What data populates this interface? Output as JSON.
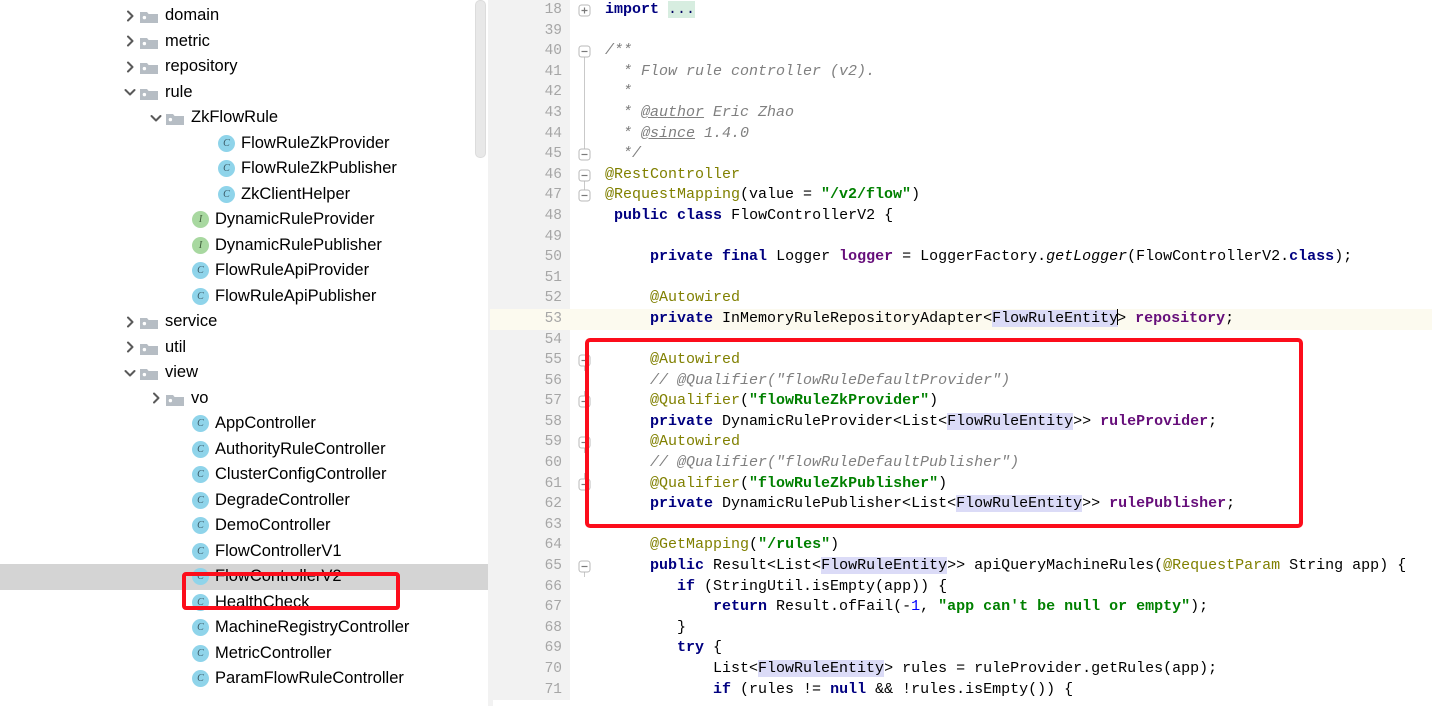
{
  "tree": {
    "scrollbar": {
      "visible": true
    },
    "items": [
      {
        "label": "domain",
        "indent": 1,
        "arrow": "right",
        "icon": "folder"
      },
      {
        "label": "metric",
        "indent": 1,
        "arrow": "right",
        "icon": "folder"
      },
      {
        "label": "repository",
        "indent": 1,
        "arrow": "right",
        "icon": "folder"
      },
      {
        "label": "rule",
        "indent": 1,
        "arrow": "down",
        "icon": "folder"
      },
      {
        "label": "ZkFlowRule",
        "indent": 2,
        "arrow": "down",
        "icon": "folder"
      },
      {
        "label": "FlowRuleZkProvider",
        "indent": 4,
        "arrow": "none",
        "icon": "class"
      },
      {
        "label": "FlowRuleZkPublisher",
        "indent": 4,
        "arrow": "none",
        "icon": "class"
      },
      {
        "label": "ZkClientHelper",
        "indent": 4,
        "arrow": "none",
        "icon": "class"
      },
      {
        "label": "DynamicRuleProvider",
        "indent": 3,
        "arrow": "none",
        "icon": "interface"
      },
      {
        "label": "DynamicRulePublisher",
        "indent": 3,
        "arrow": "none",
        "icon": "interface"
      },
      {
        "label": "FlowRuleApiProvider",
        "indent": 3,
        "arrow": "none",
        "icon": "class"
      },
      {
        "label": "FlowRuleApiPublisher",
        "indent": 3,
        "arrow": "none",
        "icon": "class"
      },
      {
        "label": "service",
        "indent": 1,
        "arrow": "right",
        "icon": "folder"
      },
      {
        "label": "util",
        "indent": 1,
        "arrow": "right",
        "icon": "folder"
      },
      {
        "label": "view",
        "indent": 1,
        "arrow": "down",
        "icon": "folder"
      },
      {
        "label": "vo",
        "indent": 2,
        "arrow": "right",
        "icon": "folder"
      },
      {
        "label": "AppController",
        "indent": 3,
        "arrow": "none",
        "icon": "class"
      },
      {
        "label": "AuthorityRuleController",
        "indent": 3,
        "arrow": "none",
        "icon": "class"
      },
      {
        "label": "ClusterConfigController",
        "indent": 3,
        "arrow": "none",
        "icon": "class"
      },
      {
        "label": "DegradeController",
        "indent": 3,
        "arrow": "none",
        "icon": "class"
      },
      {
        "label": "DemoController",
        "indent": 3,
        "arrow": "none",
        "icon": "class"
      },
      {
        "label": "FlowControllerV1",
        "indent": 3,
        "arrow": "none",
        "icon": "class"
      },
      {
        "label": "FlowControllerV2",
        "indent": 3,
        "arrow": "none",
        "icon": "class",
        "selected": true
      },
      {
        "label": "HealthCheck",
        "indent": 3,
        "arrow": "none",
        "icon": "class"
      },
      {
        "label": "MachineRegistryController",
        "indent": 3,
        "arrow": "none",
        "icon": "class"
      },
      {
        "label": "MetricController",
        "indent": 3,
        "arrow": "none",
        "icon": "class"
      },
      {
        "label": "ParamFlowRuleController",
        "indent": 3,
        "arrow": "none",
        "icon": "class"
      }
    ]
  },
  "annotations": {
    "tree_box_color": "#fc0d1b",
    "code_box_color": "#fc0d1b",
    "tree_box_target": "FlowControllerV2",
    "code_box_lines": "55-62"
  },
  "editor": {
    "current_line": 53,
    "lines": [
      {
        "num": "18",
        "fold": "plus",
        "html": "<span class=\"impkw\">import</span> <span class=\"foldtxt\">...</span>"
      },
      {
        "num": "39",
        "fold": "",
        "html": ""
      },
      {
        "num": "40",
        "fold": "minus-top",
        "html": "<span class=\"doc\">/**</span>"
      },
      {
        "num": "41",
        "fold": "line",
        "html": "<span class=\"doc\">  * Flow rule controller (v2).</span>"
      },
      {
        "num": "42",
        "fold": "line",
        "html": "<span class=\"doc\">  *</span>"
      },
      {
        "num": "43",
        "fold": "line",
        "html": "<span class=\"doc\">  * </span><span class=\"cmtu\">@author</span><span class=\"doc\"> Eric Zhao</span>"
      },
      {
        "num": "44",
        "fold": "line",
        "html": "<span class=\"doc\">  * </span><span class=\"cmtu\">@since</span><span class=\"doc\"> 1.4.0</span>"
      },
      {
        "num": "45",
        "fold": "minus-bot",
        "html": "<span class=\"doc\">  */</span>"
      },
      {
        "num": "46",
        "fold": "minus-top",
        "html": "<span class=\"ann\">@RestController</span>"
      },
      {
        "num": "47",
        "fold": "minus-bot",
        "html": "<span class=\"ann\">@RequestMapping</span>(value = <span class=\"str\">\"/v2/flow\"</span>)"
      },
      {
        "num": "48",
        "fold": "",
        "html": " <span class=\"kw\">public</span> <span class=\"kw\">class</span> FlowControllerV2 {"
      },
      {
        "num": "49",
        "fold": "",
        "html": ""
      },
      {
        "num": "50",
        "fold": "",
        "html": "     <span class=\"kw\">private</span> <span class=\"kw\">final</span> Logger <span class=\"fld\">logger</span> = LoggerFactory.<span class=\"mth\">getLogger</span>(FlowControllerV2.<span class=\"kw\">class</span>);"
      },
      {
        "num": "51",
        "fold": "",
        "html": ""
      },
      {
        "num": "52",
        "fold": "",
        "html": "     <span class=\"ann\">@Autowired</span>"
      },
      {
        "num": "53",
        "fold": "",
        "html": "     <span class=\"kw\">private</span> InMemoryRuleRepositoryAdapter&lt;<span class=\"hl\">FlowRuleEntity</span><span class=\"caret\"></span>&gt; <span class=\"fld\">repository</span>;",
        "current": true
      },
      {
        "num": "54",
        "fold": "",
        "html": ""
      },
      {
        "num": "55",
        "fold": "minus-top",
        "html": "     <span class=\"ann\">@Autowired</span>"
      },
      {
        "num": "56",
        "fold": "",
        "html": "     <span class=\"cmt\">// @Qualifier(\"flowRuleDefaultProvider\")</span>"
      },
      {
        "num": "57",
        "fold": "minus-bot",
        "html": "     <span class=\"ann\">@Qualifier</span>(<span class=\"str\">\"flowRuleZkProvider\"</span>)"
      },
      {
        "num": "58",
        "fold": "",
        "html": "     <span class=\"kw\">private</span> DynamicRuleProvider&lt;List&lt;<span class=\"hl\">FlowRuleEntity</span>&gt;&gt; <span class=\"fld\">ruleProvider</span>;"
      },
      {
        "num": "59",
        "fold": "minus-top",
        "html": "     <span class=\"ann\">@Autowired</span>"
      },
      {
        "num": "60",
        "fold": "",
        "html": "     <span class=\"cmt\">// @Qualifier(\"flowRuleDefaultPublisher\")</span>"
      },
      {
        "num": "61",
        "fold": "minus-bot",
        "html": "     <span class=\"ann\">@Qualifier</span>(<span class=\"str\">\"flowRuleZkPublisher\"</span>)"
      },
      {
        "num": "62",
        "fold": "",
        "html": "     <span class=\"kw\">private</span> DynamicRulePublisher&lt;List&lt;<span class=\"hl\">FlowRuleEntity</span>&gt;&gt; <span class=\"fld\">rulePublisher</span>;"
      },
      {
        "num": "63",
        "fold": "",
        "html": ""
      },
      {
        "num": "64",
        "fold": "",
        "html": "     <span class=\"ann\">@GetMapping</span>(<span class=\"str\">\"/rules\"</span>)"
      },
      {
        "num": "65",
        "fold": "minus-top",
        "html": "     <span class=\"kw\">public</span> Result&lt;List&lt;<span class=\"hl\">FlowRuleEntity</span>&gt;&gt; apiQueryMachineRules(<span class=\"ann\">@RequestParam</span> String app) {"
      },
      {
        "num": "66",
        "fold": "",
        "html": "        <span class=\"kw\">if</span> (StringUtil.isEmpty(app)) {"
      },
      {
        "num": "67",
        "fold": "",
        "html": "            <span class=\"kw\">return</span> Result.ofFail(-<span class=\"num\">1</span>, <span class=\"str\">\"app can't be null or empty\"</span>);"
      },
      {
        "num": "68",
        "fold": "",
        "html": "        }"
      },
      {
        "num": "69",
        "fold": "",
        "html": "        <span class=\"kw\">try</span> {"
      },
      {
        "num": "70",
        "fold": "",
        "html": "            List&lt;<span class=\"hl\">FlowRuleEntity</span>&gt; rules = ruleProvider.getRules(app);"
      },
      {
        "num": "71",
        "fold": "",
        "html": "            <span class=\"kw\">if</span> (rules != <span class=\"kw\">null</span> &amp;&amp; !rules.isEmpty()) {"
      }
    ]
  }
}
